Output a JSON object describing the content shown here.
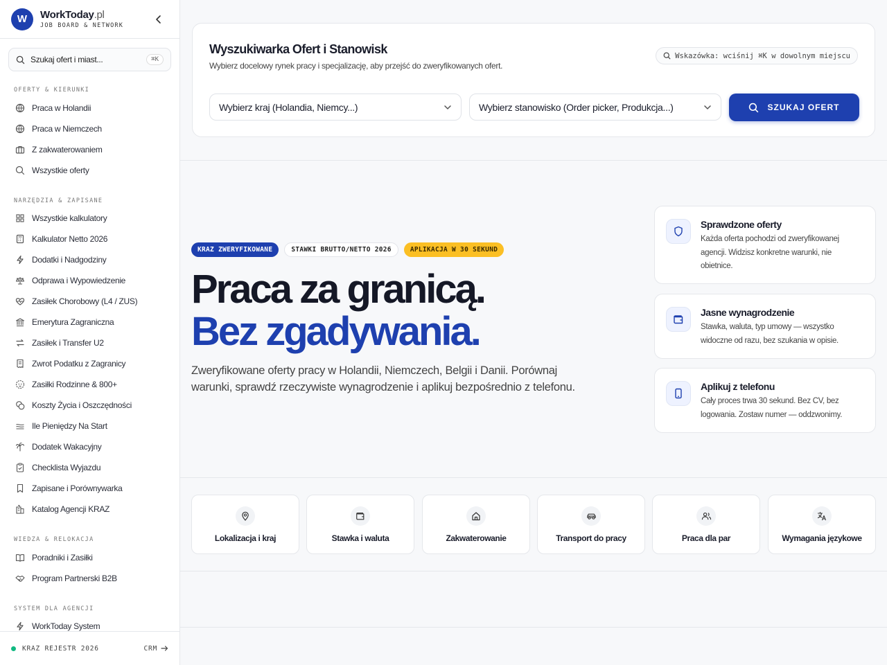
{
  "brand": {
    "name": "WorkToday",
    "tld": ".pl",
    "subtitle": "JOB BOARD & NETWORK",
    "logo_letter": "W"
  },
  "sidebar": {
    "search": {
      "placeholder": "Szukaj ofert i miast...",
      "shortcut": "⌘K"
    },
    "sections": [
      {
        "title": "OFERTY & KIERUNKI",
        "items": [
          {
            "label": "Praca w Holandii",
            "icon": "globe-icon"
          },
          {
            "label": "Praca w Niemczech",
            "icon": "globe-icon"
          },
          {
            "label": "Z zakwaterowaniem",
            "icon": "briefcase-icon"
          },
          {
            "label": "Wszystkie oferty",
            "icon": "search-icon"
          }
        ]
      },
      {
        "title": "NARZĘDZIA & ZAPISANE",
        "items": [
          {
            "label": "Wszystkie kalkulatory",
            "icon": "grid-icon"
          },
          {
            "label": "Kalkulator Netto 2026",
            "icon": "calculator-icon"
          },
          {
            "label": "Dodatki i Nadgodziny",
            "icon": "bolt-icon"
          },
          {
            "label": "Odprawa i Wypowiedzenie",
            "icon": "scale-icon"
          },
          {
            "label": "Zasiłek Chorobowy (L4 / ZUS)",
            "icon": "heart-pulse-icon"
          },
          {
            "label": "Emerytura Zagraniczna",
            "icon": "bank-icon"
          },
          {
            "label": "Zasiłek i Transfer U2",
            "icon": "transfer-icon"
          },
          {
            "label": "Zwrot Podatku z Zagranicy",
            "icon": "receipt-icon"
          },
          {
            "label": "Zasiłki Rodzinne & 800+",
            "icon": "baby-icon"
          },
          {
            "label": "Koszty Życia i Oszczędności",
            "icon": "coins-icon"
          },
          {
            "label": "Ile Pieniędzy Na Start",
            "icon": "money-icon"
          },
          {
            "label": "Dodatek Wakacyjny",
            "icon": "palm-tree-icon"
          },
          {
            "label": "Checklista Wyjazdu",
            "icon": "clipboard-check-icon"
          },
          {
            "label": "Zapisane i Porównywarka",
            "icon": "bookmark-icon"
          },
          {
            "label": "Katalog Agencji KRAZ",
            "icon": "building-icon"
          }
        ]
      },
      {
        "title": "WIEDZA & RELOKACJA",
        "items": [
          {
            "label": "Poradniki i Zasiłki",
            "icon": "book-icon"
          },
          {
            "label": "Program Partnerski B2B",
            "icon": "handshake-icon"
          }
        ]
      },
      {
        "title": "SYSTEM DLA AGENCJI",
        "items": [
          {
            "label": "WorkToday System",
            "icon": "bolt-icon"
          }
        ]
      }
    ],
    "footer": {
      "status": "KRAZ REJESTR 2026",
      "link": "CRM"
    }
  },
  "search_card": {
    "title": "Wyszukiwarka Ofert i Stanowisk",
    "subtitle": "Wybierz docelowy rynek pracy i specjalizację, aby przejść do zweryfikowanych ofert.",
    "hint": "Wskazówka: wciśnij ⌘K w dowolnym miejscu",
    "country_select": "Wybierz kraj (Holandia, Niemcy...)",
    "position_select": "Wybierz stanowisko (Order picker, Produkcja...)",
    "button": "SZUKAJ OFERT"
  },
  "hero": {
    "badges": [
      "KRAZ ZWERYFIKOWANE",
      "STAWKI BRUTTO/NETTO 2026",
      "APLIKACJA W 30 SEKUND"
    ],
    "title_line1": "Praca za granicą.",
    "title_line2": "Bez zgadywania.",
    "lead": "Zweryfikowane oferty pracy w Holandii, Niemczech, Belgii i Danii. Porównaj warunki, sprawdź rzeczywiste wynagrodzenie i aplikuj bezpośrednio z telefonu."
  },
  "features": [
    {
      "title": "Sprawdzone oferty",
      "desc": "Każda oferta pochodzi od zweryfikowanej agencji. Widzisz konkretne warunki, nie obietnice.",
      "icon": "shield-icon"
    },
    {
      "title": "Jasne wynagrodzenie",
      "desc": "Stawka, waluta, typ umowy — wszystko widoczne od razu, bez szukania w opisie.",
      "icon": "wallet-icon"
    },
    {
      "title": "Aplikuj z telefonu",
      "desc": "Cały proces trwa 30 sekund. Bez CV, bez logowania. Zostaw numer — oddzwonimy.",
      "icon": "phone-icon"
    }
  ],
  "tiles": [
    {
      "label": "Lokalizacja i kraj",
      "icon": "map-pin-icon"
    },
    {
      "label": "Stawka i waluta",
      "icon": "wallet-icon"
    },
    {
      "label": "Zakwaterowanie",
      "icon": "home-icon"
    },
    {
      "label": "Transport do pracy",
      "icon": "car-icon"
    },
    {
      "label": "Praca dla par",
      "icon": "users-icon"
    },
    {
      "label": "Wymagania językowe",
      "icon": "translate-icon"
    }
  ],
  "colors": {
    "accent": "#1e40af",
    "badge_yellow": "#fbbf24",
    "status_green": "#10b981"
  }
}
